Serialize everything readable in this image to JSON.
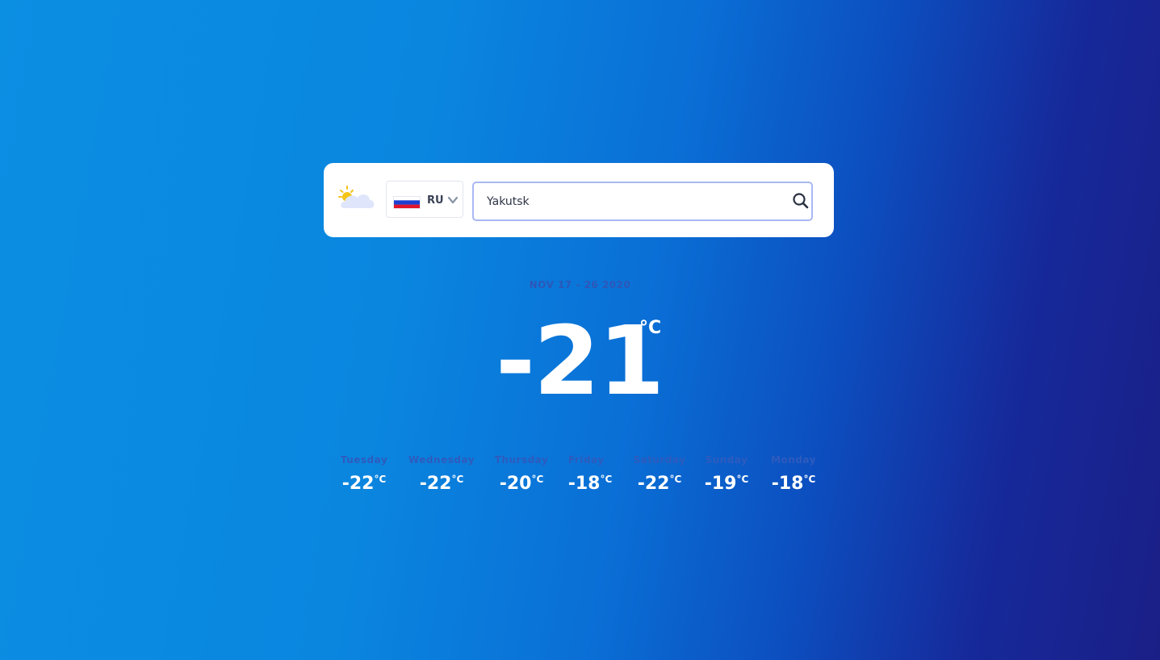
{
  "search": {
    "language_code": "RU",
    "city_value": "Yakutsk",
    "placeholder": ""
  },
  "icons": {
    "logo": "partly-cloudy-icon",
    "flag": "russia-flag-icon",
    "dropdown": "chevron-down-icon",
    "search": "search-icon"
  },
  "date_range": "NOV 17 - 26 2020",
  "current": {
    "temperature": "-21",
    "unit": "°C"
  },
  "forecast": [
    {
      "day": "Tuesday",
      "temp": "-22",
      "unit": "°C"
    },
    {
      "day": "Wednesday",
      "temp": "-22",
      "unit": "°C"
    },
    {
      "day": "Thursday",
      "temp": "-20",
      "unit": "°C"
    },
    {
      "day": "Friday",
      "temp": "-18",
      "unit": "°C"
    },
    {
      "day": "Saturday",
      "temp": "-22",
      "unit": "°C"
    },
    {
      "day": "Sunday",
      "temp": "-19",
      "unit": "°C"
    },
    {
      "day": "Monday",
      "temp": "-18",
      "unit": "°C"
    }
  ],
  "colors": {
    "background_start": "#0b8fe3",
    "background_end": "#1a1f86",
    "accent_text": "#2e5bbd",
    "search_border": "#a9b8f2"
  }
}
